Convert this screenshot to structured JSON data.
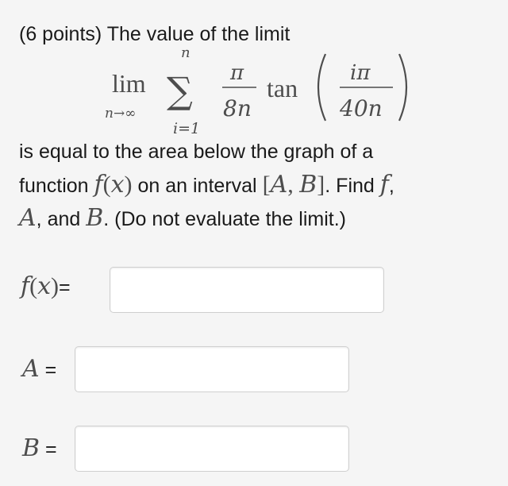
{
  "question": {
    "header": "(6 points) The value of the limit",
    "limit": {
      "lim": "lim",
      "lim_sub": "n→∞",
      "sigma": "∑",
      "sum_upper": "n",
      "sum_lower": "i=1",
      "frac1_num": "π",
      "frac1_den": "8n",
      "tan": "tan",
      "frac2_num": "iπ",
      "frac2_den": "40n"
    },
    "line2": "is equal to the area below the graph of a",
    "line3_a": "function",
    "line3_f": "f",
    "line3_x": "x",
    "line3_b": "on an interval",
    "line3_A": "A",
    "line3_B": "B",
    "line3_c": ". Find",
    "line3_f2": "f",
    "line3_comma": ",",
    "line4_A": "A",
    "line4_a": ", and",
    "line4_B": "B",
    "line4_b": ". (Do not evaluate the limit.)"
  },
  "answers": {
    "f_label": "f",
    "f_x": "x",
    "f_eq": "=",
    "A_label": "A",
    "A_eq": "=",
    "B_label": "B",
    "B_eq": "="
  }
}
